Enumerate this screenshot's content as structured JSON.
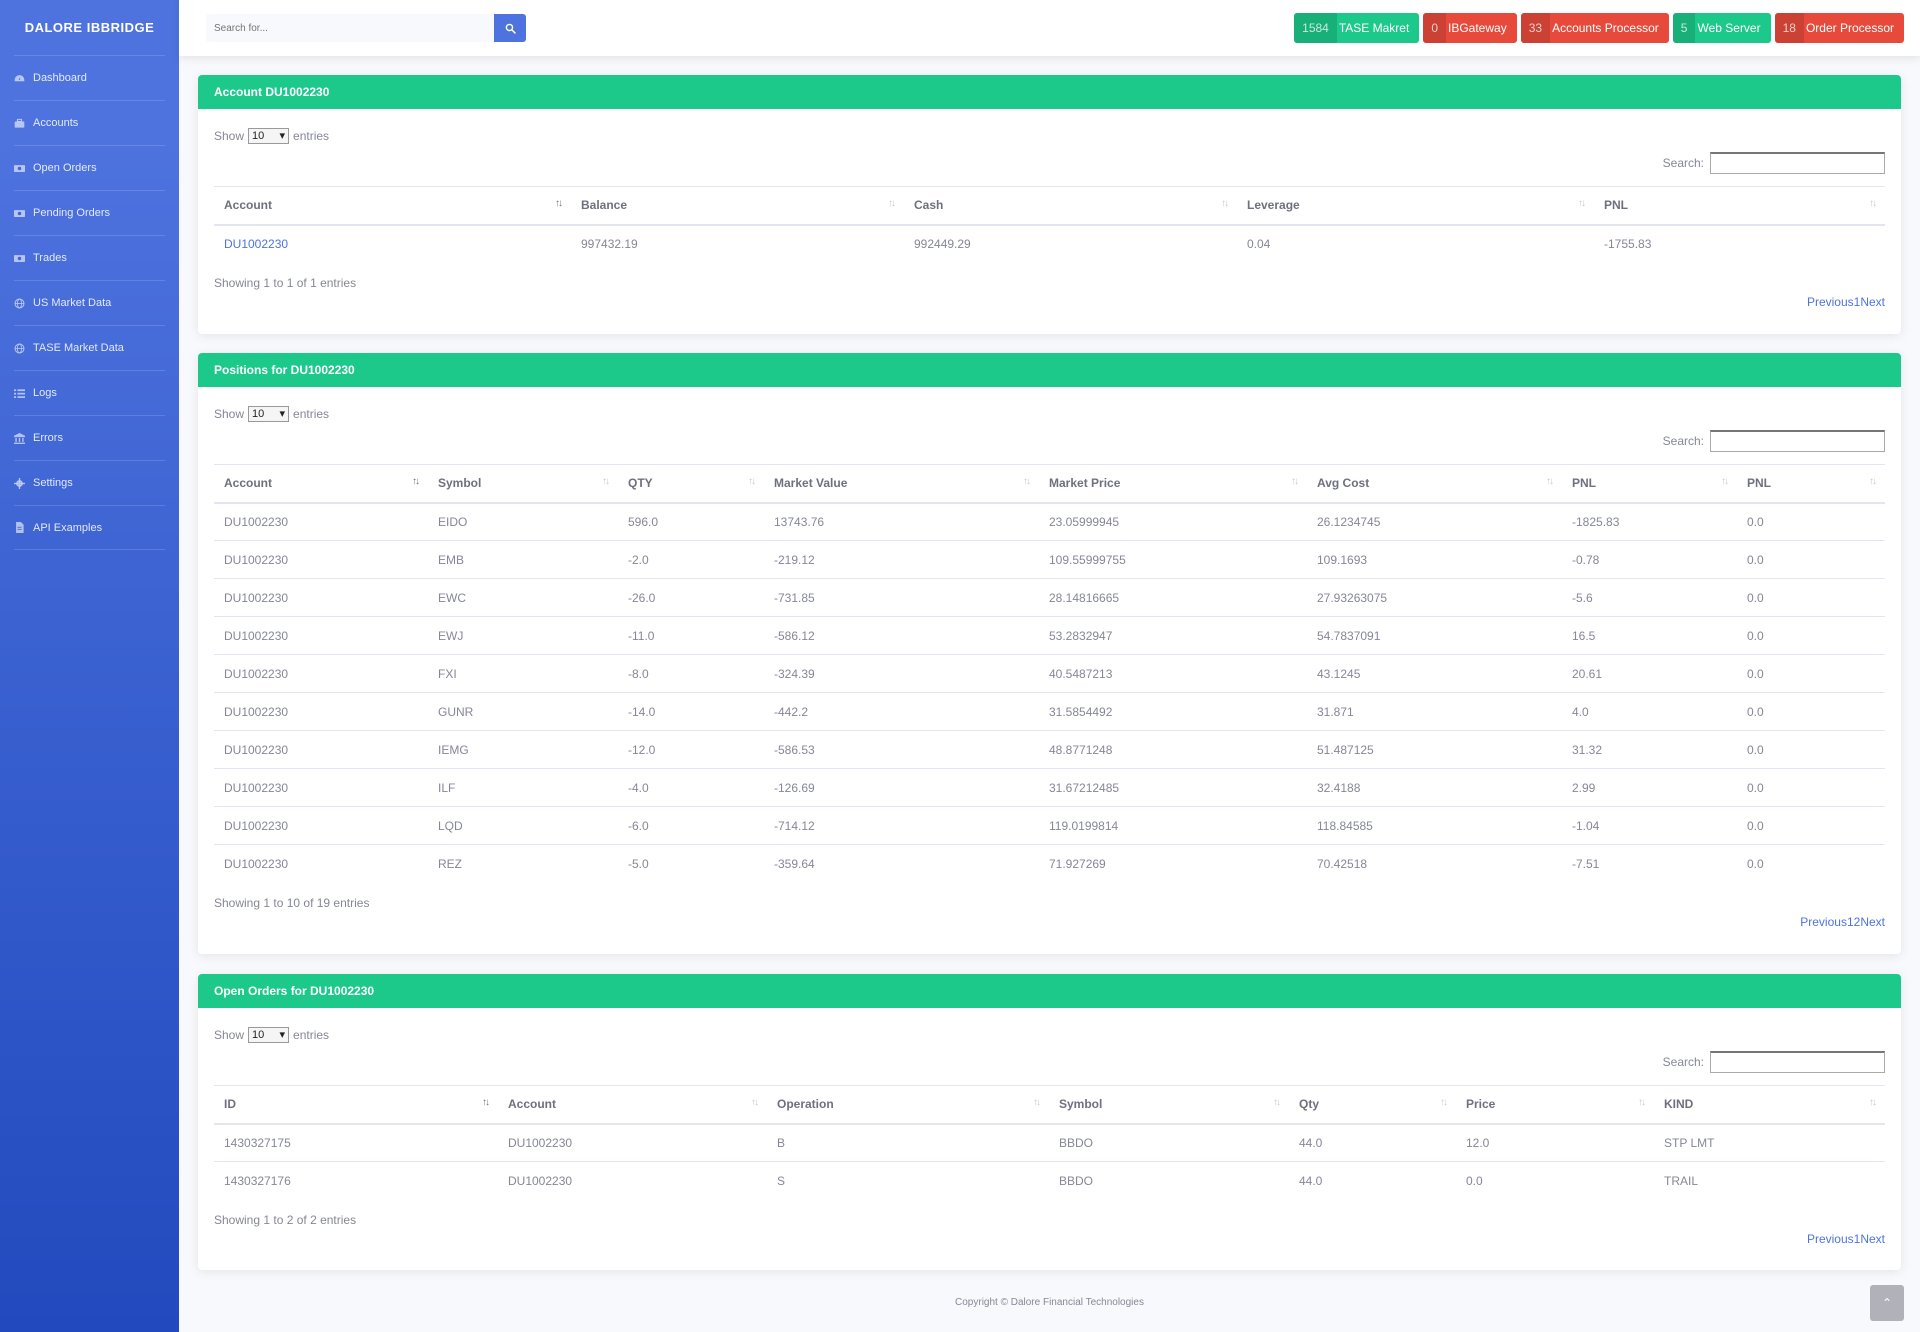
{
  "brand": "DALORE IBBRIDGE",
  "sidebar": {
    "items": [
      {
        "label": "Dashboard",
        "icon": "dashboard-icon"
      },
      {
        "label": "Accounts",
        "icon": "briefcase-icon"
      },
      {
        "label": "Open Orders",
        "icon": "money-icon"
      },
      {
        "label": "Pending Orders",
        "icon": "money-icon"
      },
      {
        "label": "Trades",
        "icon": "money-icon"
      },
      {
        "label": "US Market Data",
        "icon": "globe-icon"
      },
      {
        "label": "TASE Market Data",
        "icon": "globe-icon"
      },
      {
        "label": "Logs",
        "icon": "list-icon"
      },
      {
        "label": "Errors",
        "icon": "bank-icon"
      },
      {
        "label": "Settings",
        "icon": "gear-icon"
      },
      {
        "label": "API Examples",
        "icon": "file-icon"
      }
    ]
  },
  "search": {
    "placeholder": "Search for..."
  },
  "status": [
    {
      "count": "1584",
      "label": "TASE Makret",
      "color": "#1cc88a"
    },
    {
      "count": "0",
      "label": "IBGateway",
      "color": "#e74a3b"
    },
    {
      "count": "33",
      "label": "Accounts Processor",
      "color": "#e74a3b"
    },
    {
      "count": "5",
      "label": "Web Server",
      "color": "#1cc88a"
    },
    {
      "count": "18",
      "label": "Order Processor",
      "color": "#e74a3b"
    }
  ],
  "common": {
    "show": "Show",
    "entries": "entries",
    "length": "10",
    "search_label": "Search:"
  },
  "account_card": {
    "title": "Account DU1002230",
    "columns": [
      "Account",
      "Balance",
      "Cash",
      "Leverage",
      "PNL"
    ],
    "rows": [
      [
        "DU1002230",
        "997432.19",
        "992449.29",
        "0.04",
        "-1755.83"
      ]
    ],
    "info": "Showing 1 to 1 of 1 entries",
    "prev": "Previous",
    "pages": [
      "1"
    ],
    "next": "Next"
  },
  "positions_card": {
    "title": "Positions for DU1002230",
    "columns": [
      "Account",
      "Symbol",
      "QTY",
      "Market Value",
      "Market Price",
      "Avg Cost",
      "PNL",
      "PNL"
    ],
    "rows": [
      [
        "DU1002230",
        "EIDO",
        "596.0",
        "13743.76",
        "23.05999945",
        "26.1234745",
        "-1825.83",
        "0.0"
      ],
      [
        "DU1002230",
        "EMB",
        "-2.0",
        "-219.12",
        "109.55999755",
        "109.1693",
        "-0.78",
        "0.0"
      ],
      [
        "DU1002230",
        "EWC",
        "-26.0",
        "-731.85",
        "28.14816665",
        "27.93263075",
        "-5.6",
        "0.0"
      ],
      [
        "DU1002230",
        "EWJ",
        "-11.0",
        "-586.12",
        "53.2832947",
        "54.7837091",
        "16.5",
        "0.0"
      ],
      [
        "DU1002230",
        "FXI",
        "-8.0",
        "-324.39",
        "40.5487213",
        "43.1245",
        "20.61",
        "0.0"
      ],
      [
        "DU1002230",
        "GUNR",
        "-14.0",
        "-442.2",
        "31.5854492",
        "31.871",
        "4.0",
        "0.0"
      ],
      [
        "DU1002230",
        "IEMG",
        "-12.0",
        "-586.53",
        "48.8771248",
        "51.487125",
        "31.32",
        "0.0"
      ],
      [
        "DU1002230",
        "ILF",
        "-4.0",
        "-126.69",
        "31.67212485",
        "32.4188",
        "2.99",
        "0.0"
      ],
      [
        "DU1002230",
        "LQD",
        "-6.0",
        "-714.12",
        "119.0199814",
        "118.84585",
        "-1.04",
        "0.0"
      ],
      [
        "DU1002230",
        "REZ",
        "-5.0",
        "-359.64",
        "71.927269",
        "70.42518",
        "-7.51",
        "0.0"
      ]
    ],
    "info": "Showing 1 to 10 of 19 entries",
    "prev": "Previous",
    "pages": [
      "1",
      "2"
    ],
    "next": "Next"
  },
  "orders_card": {
    "title": "Open Orders for DU1002230",
    "columns": [
      "ID",
      "Account",
      "Operation",
      "Symbol",
      "Qty",
      "Price",
      "KIND"
    ],
    "rows": [
      [
        "1430327175",
        "DU1002230",
        "B",
        "BBDO",
        "44.0",
        "12.0",
        "STP LMT"
      ],
      [
        "1430327176",
        "DU1002230",
        "S",
        "BBDO",
        "44.0",
        "0.0",
        "TRAIL"
      ]
    ],
    "info": "Showing 1 to 2 of 2 entries",
    "prev": "Previous",
    "pages": [
      "1"
    ],
    "next": "Next"
  },
  "footer": "Copyright © Dalore Financial Technologies",
  "scroll_top_icon": "chevron-up-icon"
}
